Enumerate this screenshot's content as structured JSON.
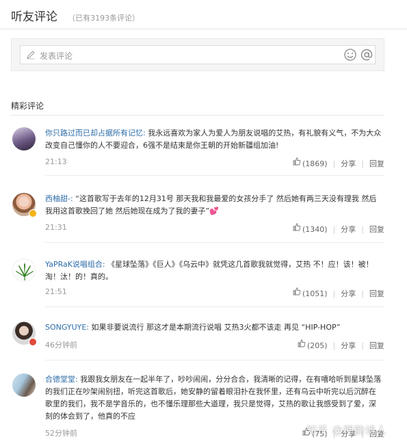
{
  "header": {
    "title": "听友评论",
    "count_note": "（已有3193条评论）"
  },
  "input": {
    "placeholder": "发表评论",
    "icons": [
      "pen-icon",
      "emoji-icon",
      "at-icon"
    ]
  },
  "section": {
    "title": "精彩评论"
  },
  "comments": [
    {
      "user": "你只路过而已却占据所有记忆:",
      "text": " 我永远喜欢为家人为爱人为朋友说唱的艾热，有礼貌有义气，不为大众改变自己懂你的人不要迎合，6强不是结束是你王朝的开始新疆组加油!",
      "time": "21:13",
      "likes": "(1869)",
      "share": "分享",
      "reply": "回复"
    },
    {
      "user": "西柚甜-:",
      "text": " “这首歌写于去年的12月31号 那天我和我最爱的女孩分手了 然后她有两三天没有理我 然后我用这首歌挽回了她 然后她现在成为了我的妻子”💕",
      "time": "21:31",
      "likes": "(1340)",
      "share": "分享",
      "reply": "回复"
    },
    {
      "user": "YaPRaK说唱组合:",
      "text": " 《星球坠落》《巨人》《乌云中》就凭这几首歌我就觉得，艾热 不！应！该！被！淘！汰！的！真的。",
      "time": "21:51",
      "likes": "(1051)",
      "share": "分享",
      "reply": "回复"
    },
    {
      "user": "SONGYUYE:",
      "text": " 如果非要说流行 那这才是本期流行说唱 艾热3火都不该走 再见 “HIP-HOP”",
      "time": "46分钟前",
      "likes": "(205)",
      "share": "分享",
      "reply": "回复"
    },
    {
      "user": "合德堂堂:",
      "text": " 我跟我女朋友在一起半年了，吵吵闹闹，分分合合，我清晰的记得，在有嘻哈听到星球坠落的我们正在吵架闹别扭，听完这首歌后，她安静的留着眼泪扑在我怀里，还有乌云中听完以后沉醉在歌里的我们，我不是学音乐的，也不懂乐理那些大道理，我只是觉得，艾热的歌让我感受到了爱，深刻的体会到了，他真的不应",
      "time": "52分钟前",
      "likes": "(75)",
      "share": "分享",
      "reply": "回复"
    }
  ],
  "watermark": "知乎 @押韵诗人",
  "colors": {
    "username": "#2b6ba8",
    "meta": "#999999",
    "text": "#333333"
  }
}
